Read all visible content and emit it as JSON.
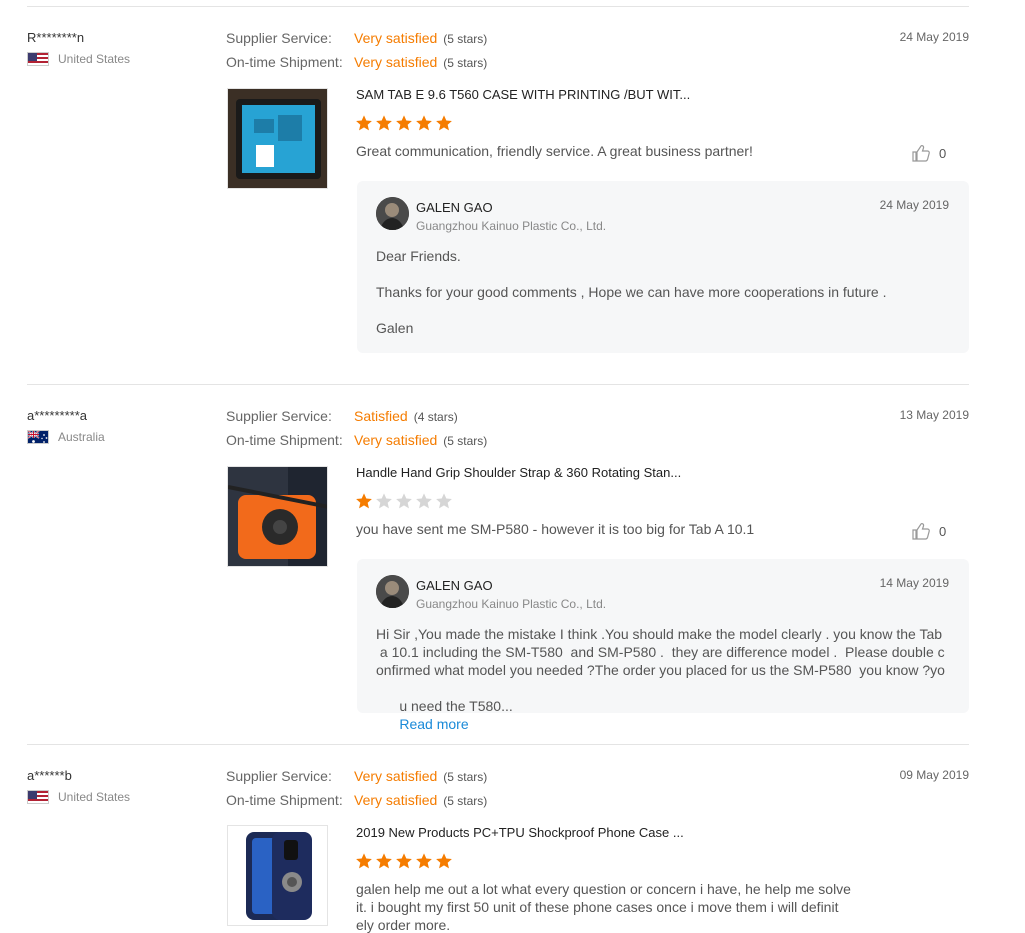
{
  "reviews": [
    {
      "buyer": "R********n",
      "country": "United States",
      "supplier_label": "Supplier Service:",
      "supplier_value": "Very satisfied",
      "supplier_stars": "(5 stars)",
      "shipment_label": "On-time Shipment:",
      "shipment_value": "Very satisfied",
      "shipment_stars": "(5 stars)",
      "date": "24 May 2019",
      "product_title": "SAM TAB E 9.6 T560 CASE WITH PRINTING /BUT WIT...",
      "product_rating": 5,
      "text": "Great communication, friendly service. A great business partner!",
      "helpful_count": "0",
      "reply": {
        "name": "GALEN GAO",
        "company": "Guangzhou Kainuo Plastic Co., Ltd.",
        "date": "24 May 2019",
        "p1": "Dear Friends.",
        "p2": "Thanks for your good comments , Hope we can have more cooperations in future .",
        "p3": "Galen"
      }
    },
    {
      "buyer": "a*********a",
      "country": "Australia",
      "supplier_label": "Supplier Service:",
      "supplier_value": "Satisfied",
      "supplier_stars": "(4 stars)",
      "shipment_label": "On-time Shipment:",
      "shipment_value": "Very satisfied",
      "shipment_stars": "(5 stars)",
      "date": "13 May 2019",
      "product_title": "Handle Hand Grip Shoulder Strap & 360 Rotating Stan...",
      "product_rating": 1,
      "text": "you have sent me SM-P580 - however it is too big for Tab A 10.1",
      "helpful_count": "0",
      "reply": {
        "name": "GALEN GAO",
        "company": "Guangzhou Kainuo Plastic Co., Ltd.",
        "date": "14 May 2019",
        "line1": "Hi Sir ,You made the mistake I think .You should make the model clearly . you know the Tab",
        "line2": " a 10.1 including the SM-T580  and SM-P580 .  they are difference model .  Please double c",
        "line3": "onfirmed what model you needed ?The order you placed for us the SM-P580  you know ?yo",
        "line4": "u need the T580...",
        "read_more": "Read more"
      }
    },
    {
      "buyer": "a******b",
      "country": "United States",
      "supplier_label": "Supplier Service:",
      "supplier_value": "Very satisfied",
      "supplier_stars": "(5 stars)",
      "shipment_label": "On-time Shipment:",
      "shipment_value": "Very satisfied",
      "shipment_stars": "(5 stars)",
      "date": "09 May 2019",
      "product_title": "2019 New Products PC+TPU Shockproof Phone Case ...",
      "product_rating": 5,
      "line1": "galen help me out a lot what every question or concern i have, he help me solve",
      "line2": "it. i bought my first 50 unit of these phone cases once i move them i will definit",
      "line3": "ely order more."
    }
  ],
  "colors": {
    "accent": "#f57c00",
    "link": "#1a8ad8",
    "star_empty": "#d6d6d6"
  }
}
